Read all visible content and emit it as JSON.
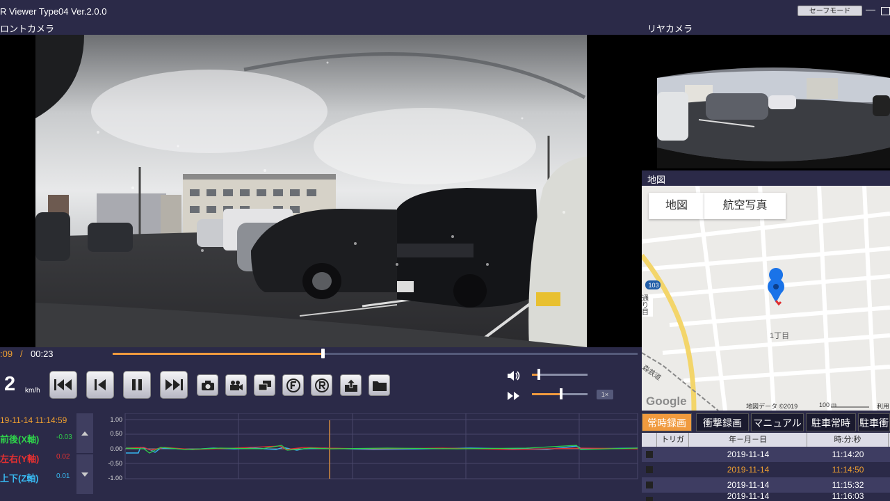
{
  "app": {
    "title": "R Viewer Type04 Ver.2.0.0",
    "safe_mode_label": "セーフモード",
    "minimize_glyph": "—"
  },
  "cameras": {
    "front_label": "ロントカメラ",
    "rear_label": "リヤカメラ"
  },
  "map": {
    "section_label": "地図",
    "tab_map": "地図",
    "tab_aerial": "航空写真",
    "route_number": "103",
    "area_label": "1丁目",
    "side_label": "通り\n目",
    "rail_label": "森鉄道",
    "google_logo": "Google",
    "attribution": "地図データ ©2019",
    "scale_label": "100 m",
    "terms": "利用"
  },
  "playback": {
    "current_time": ":09",
    "separator": "/",
    "total_time": "00:23",
    "progress": 0.4,
    "speed_value": "2",
    "speed_unit": "km/h",
    "volume": 0.12,
    "rate": 0.52,
    "rate_badge": "1×"
  },
  "controls": [
    {
      "name": "skip-start-button",
      "icon": "skip-to-start-icon"
    },
    {
      "name": "prev-frame-button",
      "icon": "step-back-icon"
    },
    {
      "name": "pause-button",
      "icon": "pause-icon"
    },
    {
      "name": "skip-end-button",
      "icon": "skip-to-end-icon"
    },
    {
      "name": "snapshot-button",
      "icon": "camera-icon"
    },
    {
      "name": "clip-button",
      "icon": "video-camera-icon"
    },
    {
      "name": "window-button",
      "icon": "window-icon"
    },
    {
      "name": "front-view-button",
      "icon": "f-circle-icon"
    },
    {
      "name": "rear-view-button",
      "icon": "r-circle-icon"
    },
    {
      "name": "export-button",
      "icon": "upload-folder-icon"
    },
    {
      "name": "open-folder-button",
      "icon": "folder-icon"
    }
  ],
  "gsensor": {
    "datetime": "19-11-14 11:14:59",
    "axes": [
      {
        "label": "前後(X軸)",
        "value": "-0.03",
        "color": "#2ed24a"
      },
      {
        "label": "左右(Y軸)",
        "value": "0.02",
        "color": "#e83030"
      },
      {
        "label": "上下(Z軸)",
        "value": "0.01",
        "color": "#38b8f0"
      }
    ],
    "y_ticks": [
      "1.00",
      "0.50",
      "0.00",
      "-0.50",
      "-1.00"
    ]
  },
  "recordings": {
    "tabs": [
      "常時録画",
      "衝撃録画",
      "マニュアル",
      "駐車常時",
      "駐車衝"
    ],
    "active_tab": 0,
    "headers": {
      "trigger": "トリガ",
      "date": "年－月－日",
      "time": "時:分:秒"
    },
    "rows": [
      {
        "date": "2019-11-14",
        "time": "11:14:20",
        "highlight": false
      },
      {
        "date": "2019-11-14",
        "time": "11:14:50",
        "highlight": true
      },
      {
        "date": "2019-11-14",
        "time": "11:15:32",
        "highlight": false
      },
      {
        "date": "2019-11-14",
        "time": "11:16:03",
        "highlight": false
      }
    ]
  },
  "colors": {
    "accent": "#f09a3e",
    "panel_bg": "#2b2a48",
    "highlight_text": "#f0a030"
  }
}
